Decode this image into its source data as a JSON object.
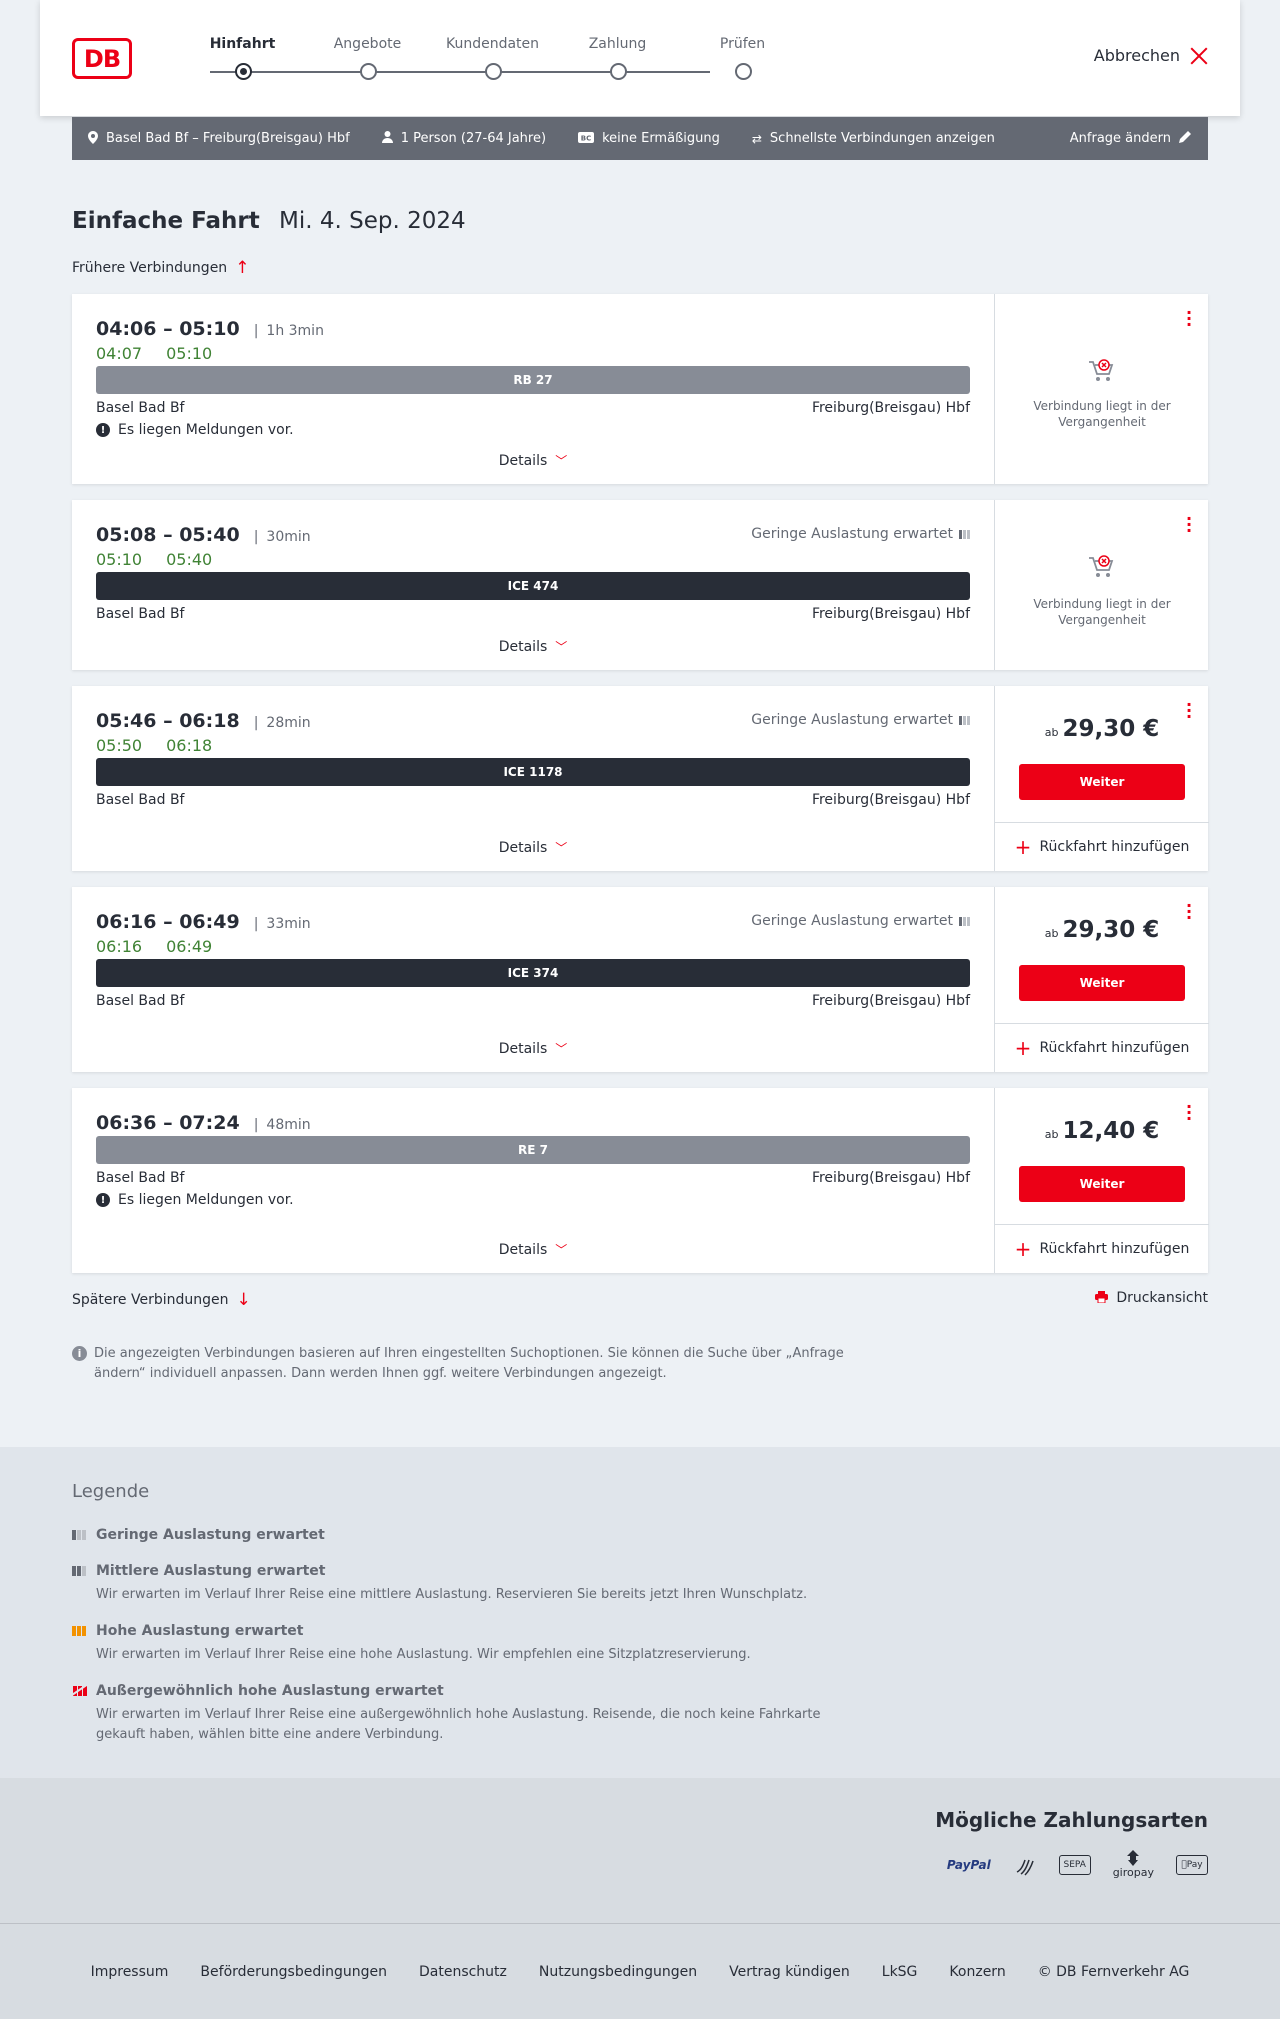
{
  "header": {
    "logo_text": "DB",
    "steps": [
      {
        "label": "Hinfahrt",
        "active": true
      },
      {
        "label": "Angebote",
        "active": false
      },
      {
        "label": "Kundendaten",
        "active": false
      },
      {
        "label": "Zahlung",
        "active": false
      },
      {
        "label": "Prüfen",
        "active": false
      }
    ],
    "cancel_label": "Abbrechen"
  },
  "query": {
    "route": "Basel Bad Bf – Freiburg(Breisgau) Hbf",
    "passengers": "1 Person (27-64 Jahre)",
    "discount": "keine Ermäßigung",
    "fastest": "Schnellste Verbindungen anzeigen",
    "change": "Anfrage ändern"
  },
  "title": {
    "trip_type": "Einfache Fahrt",
    "date": "Mi. 4. Sep. 2024"
  },
  "earlier_label": "Frühere Verbindungen",
  "later_label": "Spätere Verbindungen",
  "print_label": "Druckansicht",
  "connections": [
    {
      "times": "04:06 – 05:10",
      "duration": "1h 3min",
      "rt_dep": "04:07",
      "rt_arr": "05:10",
      "train": "RB 27",
      "from": "Basel Bad Bf",
      "to": "Freiburg(Breisgau) Hbf",
      "message": "Es liegen Meldungen vor.",
      "details": "Details",
      "past_text": "Verbindung liegt in der Vergangenheit"
    },
    {
      "times": "05:08 – 05:40",
      "duration": "30min",
      "rt_dep": "05:10",
      "rt_arr": "05:40",
      "load": "Geringe Auslastung erwartet",
      "train": "ICE 474",
      "from": "Basel Bad Bf",
      "to": "Freiburg(Breisgau) Hbf",
      "details": "Details",
      "past_text": "Verbindung liegt in der Vergangenheit"
    },
    {
      "times": "05:46 – 06:18",
      "duration": "28min",
      "rt_dep": "05:50",
      "rt_arr": "06:18",
      "load": "Geringe Auslastung erwartet",
      "train": "ICE 1178",
      "from": "Basel Bad Bf",
      "to": "Freiburg(Breisgau) Hbf",
      "details": "Details",
      "price_prefix": "ab",
      "price": "29,30 €",
      "weiter": "Weiter",
      "return": "Rückfahrt hinzufügen"
    },
    {
      "times": "06:16 – 06:49",
      "duration": "33min",
      "rt_dep": "06:16",
      "rt_arr": "06:49",
      "load": "Geringe Auslastung erwartet",
      "train": "ICE 374",
      "from": "Basel Bad Bf",
      "to": "Freiburg(Breisgau) Hbf",
      "details": "Details",
      "price_prefix": "ab",
      "price": "29,30 €",
      "weiter": "Weiter",
      "return": "Rückfahrt hinzufügen"
    },
    {
      "times": "06:36 – 07:24",
      "duration": "48min",
      "train": "RE 7",
      "from": "Basel Bad Bf",
      "to": "Freiburg(Breisgau) Hbf",
      "message": "Es liegen Meldungen vor.",
      "details": "Details",
      "price_prefix": "ab",
      "price": "12,40 €",
      "weiter": "Weiter",
      "return": "Rückfahrt hinzufügen"
    }
  ],
  "info_text": "Die angezeigten Verbindungen basieren auf Ihren eingestellten Suchoptionen. Sie können die Suche über „Anfrage ändern“ individuell anpassen. Dann werden Ihnen ggf. weitere Verbindungen angezeigt.",
  "legend": {
    "title": "Legende",
    "items": [
      {
        "title": "Geringe Auslastung erwartet",
        "desc": ""
      },
      {
        "title": "Mittlere Auslastung erwartet",
        "desc": "Wir erwarten im Verlauf Ihrer Reise eine mittlere Auslastung. Reservieren Sie bereits jetzt Ihren Wunschplatz."
      },
      {
        "title": "Hohe Auslastung erwartet",
        "desc": "Wir erwarten im Verlauf Ihrer Reise eine hohe Auslastung. Wir empfehlen eine Sitzplatzreservierung."
      },
      {
        "title": "Außergewöhnlich hohe Auslastung erwartet",
        "desc": "Wir erwarten im Verlauf Ihrer Reise eine außergewöhnlich hohe Auslastung. Reisende, die noch keine Fahrkarte gekauft haben, wählen bitte eine andere Verbindung."
      }
    ]
  },
  "payment": {
    "title": "Mögliche Zahlungsarten",
    "methods": [
      "PayPal",
      "SEPA",
      "giropay",
      "Pay"
    ]
  },
  "footer": {
    "links": [
      "Impressum",
      "Beförderungsbedingungen",
      "Datenschutz",
      "Nutzungsbedingungen",
      "Vertrag kündigen",
      "LkSG",
      "Konzern",
      "© DB Fernverkehr AG"
    ]
  },
  "colors": {
    "accent": "#ec0016",
    "realtime": "#408335",
    "querybar": "#646973"
  }
}
